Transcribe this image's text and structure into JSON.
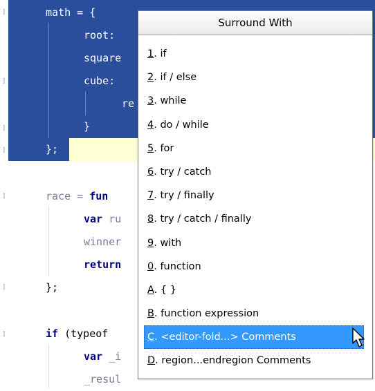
{
  "editor": {
    "lines": [
      {
        "name": "line-math",
        "tokens": [
          {
            "t": "math = {"
          }
        ]
      },
      {
        "name": "line-root",
        "tokens": [
          {
            "t": "root:"
          }
        ]
      },
      {
        "name": "line-square",
        "tokens": [
          {
            "t": "square"
          }
        ]
      },
      {
        "name": "line-cube",
        "tokens": [
          {
            "t": "cube:"
          }
        ]
      },
      {
        "name": "line-return-inner",
        "tokens": [
          {
            "t": "re"
          }
        ]
      },
      {
        "name": "line-close-inner",
        "tokens": [
          {
            "t": "}"
          }
        ]
      },
      {
        "name": "line-close-math",
        "tokens": [
          {
            "t": "};"
          }
        ]
      },
      {
        "name": "line-race",
        "tokens": [
          {
            "t": "race = ",
            "c": "dim"
          },
          {
            "t": "fun",
            "c": "kw"
          }
        ]
      },
      {
        "name": "line-var-ru",
        "tokens": [
          {
            "t": "var ",
            "c": "kw"
          },
          {
            "t": "ru",
            "c": "dim"
          }
        ]
      },
      {
        "name": "line-winner",
        "tokens": [
          {
            "t": "winner",
            "c": "dim"
          }
        ]
      },
      {
        "name": "line-return",
        "tokens": [
          {
            "t": "return",
            "c": "kw"
          }
        ]
      },
      {
        "name": "line-close-race",
        "tokens": [
          {
            "t": "};",
            "c": "op"
          }
        ]
      },
      {
        "name": "line-if-typeof",
        "tokens": [
          {
            "t": "if ",
            "c": "kw"
          },
          {
            "t": "(typeof",
            "c": "op"
          }
        ]
      },
      {
        "name": "line-var-i",
        "tokens": [
          {
            "t": "var ",
            "c": "kw"
          },
          {
            "t": "_i",
            "c": "dim"
          }
        ]
      },
      {
        "name": "line-result",
        "tokens": [
          {
            "t": "_resul",
            "c": "dim"
          }
        ]
      }
    ]
  },
  "popup": {
    "title": "Surround With",
    "items": [
      {
        "mnemonic": "1",
        "rest": ". if",
        "name": "menu-item-if"
      },
      {
        "mnemonic": "2",
        "rest": ". if / else",
        "name": "menu-item-if-else"
      },
      {
        "mnemonic": "3",
        "rest": ". while",
        "name": "menu-item-while"
      },
      {
        "mnemonic": "4",
        "rest": ". do / while",
        "name": "menu-item-do-while"
      },
      {
        "mnemonic": "5",
        "rest": ". for",
        "name": "menu-item-for"
      },
      {
        "mnemonic": "6",
        "rest": ". try / catch",
        "name": "menu-item-try-catch"
      },
      {
        "mnemonic": "7",
        "rest": ". try / finally",
        "name": "menu-item-try-finally"
      },
      {
        "mnemonic": "8",
        "rest": ". try / catch / finally",
        "name": "menu-item-try-catch-finally"
      },
      {
        "mnemonic": "9",
        "rest": ". with",
        "name": "menu-item-with"
      },
      {
        "mnemonic": "0",
        "rest": ". function",
        "name": "menu-item-function"
      },
      {
        "mnemonic": "A",
        "rest": ". { }",
        "name": "menu-item-braces"
      },
      {
        "mnemonic": "B",
        "rest": ". function expression",
        "name": "menu-item-function-expression"
      },
      {
        "mnemonic": "C",
        "rest": ". <editor-fold...> Comments",
        "name": "menu-item-editor-fold-comments",
        "selected": true
      },
      {
        "mnemonic": "D",
        "rest": ". region...endregion Comments",
        "name": "menu-item-region-comments"
      }
    ],
    "cursor_icon": "arrow-pointer-icon"
  }
}
